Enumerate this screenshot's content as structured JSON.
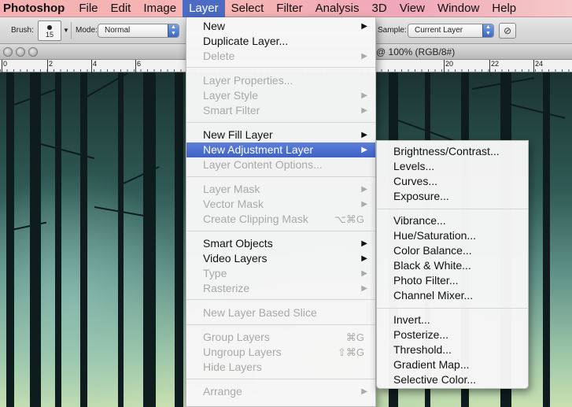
{
  "menubar": {
    "app_name": "Photoshop",
    "items": [
      "File",
      "Edit",
      "Image",
      "Layer",
      "Select",
      "Filter",
      "Analysis",
      "3D",
      "View",
      "Window",
      "Help"
    ],
    "active_item": "Layer"
  },
  "options_bar": {
    "brush_label": "Brush:",
    "brush_size": "15",
    "mode_label": "Mode:",
    "mode_value": "Normal",
    "sample_label": "Sample:",
    "sample_value": "Current Layer",
    "ignore_adjustment_icon": "ignore-adjustment-layers-icon"
  },
  "document": {
    "title_fragment": "@ 100% (RGB/8#)"
  },
  "ruler": {
    "labels": [
      "0",
      "2",
      "4",
      "6",
      "20",
      "22",
      "24"
    ]
  },
  "layer_menu": {
    "new": "New",
    "duplicate_layer": "Duplicate Layer...",
    "delete": "Delete",
    "layer_properties": "Layer Properties...",
    "layer_style": "Layer Style",
    "smart_filter": "Smart Filter",
    "new_fill_layer": "New Fill Layer",
    "new_adjustment_layer": "New Adjustment Layer",
    "layer_content_options": "Layer Content Options...",
    "layer_mask": "Layer Mask",
    "vector_mask": "Vector Mask",
    "create_clipping_mask": "Create Clipping Mask",
    "create_clipping_mask_shortcut": "⌥⌘G",
    "smart_objects": "Smart Objects",
    "video_layers": "Video Layers",
    "type": "Type",
    "rasterize": "Rasterize",
    "new_layer_based_slice": "New Layer Based Slice",
    "group_layers": "Group Layers",
    "group_layers_shortcut": "⌘G",
    "ungroup_layers": "Ungroup Layers",
    "ungroup_layers_shortcut": "⇧⌘G",
    "hide_layers": "Hide Layers",
    "arrange": "Arrange",
    "submenu_arrow": "▶"
  },
  "adjustment_submenu": {
    "brightness_contrast": "Brightness/Contrast...",
    "levels": "Levels...",
    "curves": "Curves...",
    "exposure": "Exposure...",
    "vibrance": "Vibrance...",
    "hue_saturation": "Hue/Saturation...",
    "color_balance": "Color Balance...",
    "black_white": "Black & White...",
    "photo_filter": "Photo Filter...",
    "channel_mixer": "Channel Mixer...",
    "invert": "Invert...",
    "posterize": "Posterize...",
    "threshold": "Threshold...",
    "gradient_map": "Gradient Map...",
    "selective_color": "Selective Color..."
  },
  "colors": {
    "menu_highlight": "#3e63c6",
    "menubar_tint": "#f4b0b2",
    "disabled_text": "#a9a9a9"
  }
}
